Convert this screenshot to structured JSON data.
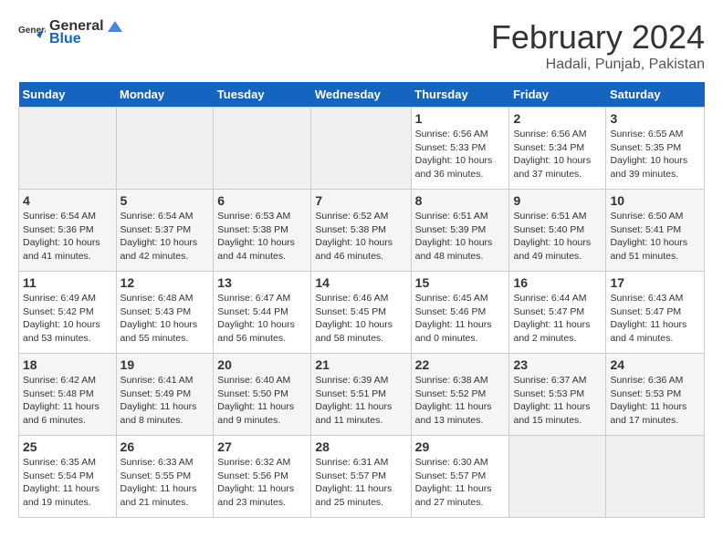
{
  "header": {
    "logo_general": "General",
    "logo_blue": "Blue",
    "title": "February 2024",
    "subtitle": "Hadali, Punjab, Pakistan"
  },
  "columns": [
    "Sunday",
    "Monday",
    "Tuesday",
    "Wednesday",
    "Thursday",
    "Friday",
    "Saturday"
  ],
  "weeks": [
    [
      {
        "day": "",
        "sunrise": "",
        "sunset": "",
        "daylight": "",
        "empty": true
      },
      {
        "day": "",
        "sunrise": "",
        "sunset": "",
        "daylight": "",
        "empty": true
      },
      {
        "day": "",
        "sunrise": "",
        "sunset": "",
        "daylight": "",
        "empty": true
      },
      {
        "day": "",
        "sunrise": "",
        "sunset": "",
        "daylight": "",
        "empty": true
      },
      {
        "day": "1",
        "sunrise": "Sunrise: 6:56 AM",
        "sunset": "Sunset: 5:33 PM",
        "daylight": "Daylight: 10 hours and 36 minutes.",
        "empty": false
      },
      {
        "day": "2",
        "sunrise": "Sunrise: 6:56 AM",
        "sunset": "Sunset: 5:34 PM",
        "daylight": "Daylight: 10 hours and 37 minutes.",
        "empty": false
      },
      {
        "day": "3",
        "sunrise": "Sunrise: 6:55 AM",
        "sunset": "Sunset: 5:35 PM",
        "daylight": "Daylight: 10 hours and 39 minutes.",
        "empty": false
      }
    ],
    [
      {
        "day": "4",
        "sunrise": "Sunrise: 6:54 AM",
        "sunset": "Sunset: 5:36 PM",
        "daylight": "Daylight: 10 hours and 41 minutes.",
        "empty": false
      },
      {
        "day": "5",
        "sunrise": "Sunrise: 6:54 AM",
        "sunset": "Sunset: 5:37 PM",
        "daylight": "Daylight: 10 hours and 42 minutes.",
        "empty": false
      },
      {
        "day": "6",
        "sunrise": "Sunrise: 6:53 AM",
        "sunset": "Sunset: 5:38 PM",
        "daylight": "Daylight: 10 hours and 44 minutes.",
        "empty": false
      },
      {
        "day": "7",
        "sunrise": "Sunrise: 6:52 AM",
        "sunset": "Sunset: 5:38 PM",
        "daylight": "Daylight: 10 hours and 46 minutes.",
        "empty": false
      },
      {
        "day": "8",
        "sunrise": "Sunrise: 6:51 AM",
        "sunset": "Sunset: 5:39 PM",
        "daylight": "Daylight: 10 hours and 48 minutes.",
        "empty": false
      },
      {
        "day": "9",
        "sunrise": "Sunrise: 6:51 AM",
        "sunset": "Sunset: 5:40 PM",
        "daylight": "Daylight: 10 hours and 49 minutes.",
        "empty": false
      },
      {
        "day": "10",
        "sunrise": "Sunrise: 6:50 AM",
        "sunset": "Sunset: 5:41 PM",
        "daylight": "Daylight: 10 hours and 51 minutes.",
        "empty": false
      }
    ],
    [
      {
        "day": "11",
        "sunrise": "Sunrise: 6:49 AM",
        "sunset": "Sunset: 5:42 PM",
        "daylight": "Daylight: 10 hours and 53 minutes.",
        "empty": false
      },
      {
        "day": "12",
        "sunrise": "Sunrise: 6:48 AM",
        "sunset": "Sunset: 5:43 PM",
        "daylight": "Daylight: 10 hours and 55 minutes.",
        "empty": false
      },
      {
        "day": "13",
        "sunrise": "Sunrise: 6:47 AM",
        "sunset": "Sunset: 5:44 PM",
        "daylight": "Daylight: 10 hours and 56 minutes.",
        "empty": false
      },
      {
        "day": "14",
        "sunrise": "Sunrise: 6:46 AM",
        "sunset": "Sunset: 5:45 PM",
        "daylight": "Daylight: 10 hours and 58 minutes.",
        "empty": false
      },
      {
        "day": "15",
        "sunrise": "Sunrise: 6:45 AM",
        "sunset": "Sunset: 5:46 PM",
        "daylight": "Daylight: 11 hours and 0 minutes.",
        "empty": false
      },
      {
        "day": "16",
        "sunrise": "Sunrise: 6:44 AM",
        "sunset": "Sunset: 5:47 PM",
        "daylight": "Daylight: 11 hours and 2 minutes.",
        "empty": false
      },
      {
        "day": "17",
        "sunrise": "Sunrise: 6:43 AM",
        "sunset": "Sunset: 5:47 PM",
        "daylight": "Daylight: 11 hours and 4 minutes.",
        "empty": false
      }
    ],
    [
      {
        "day": "18",
        "sunrise": "Sunrise: 6:42 AM",
        "sunset": "Sunset: 5:48 PM",
        "daylight": "Daylight: 11 hours and 6 minutes.",
        "empty": false
      },
      {
        "day": "19",
        "sunrise": "Sunrise: 6:41 AM",
        "sunset": "Sunset: 5:49 PM",
        "daylight": "Daylight: 11 hours and 8 minutes.",
        "empty": false
      },
      {
        "day": "20",
        "sunrise": "Sunrise: 6:40 AM",
        "sunset": "Sunset: 5:50 PM",
        "daylight": "Daylight: 11 hours and 9 minutes.",
        "empty": false
      },
      {
        "day": "21",
        "sunrise": "Sunrise: 6:39 AM",
        "sunset": "Sunset: 5:51 PM",
        "daylight": "Daylight: 11 hours and 11 minutes.",
        "empty": false
      },
      {
        "day": "22",
        "sunrise": "Sunrise: 6:38 AM",
        "sunset": "Sunset: 5:52 PM",
        "daylight": "Daylight: 11 hours and 13 minutes.",
        "empty": false
      },
      {
        "day": "23",
        "sunrise": "Sunrise: 6:37 AM",
        "sunset": "Sunset: 5:53 PM",
        "daylight": "Daylight: 11 hours and 15 minutes.",
        "empty": false
      },
      {
        "day": "24",
        "sunrise": "Sunrise: 6:36 AM",
        "sunset": "Sunset: 5:53 PM",
        "daylight": "Daylight: 11 hours and 17 minutes.",
        "empty": false
      }
    ],
    [
      {
        "day": "25",
        "sunrise": "Sunrise: 6:35 AM",
        "sunset": "Sunset: 5:54 PM",
        "daylight": "Daylight: 11 hours and 19 minutes.",
        "empty": false
      },
      {
        "day": "26",
        "sunrise": "Sunrise: 6:33 AM",
        "sunset": "Sunset: 5:55 PM",
        "daylight": "Daylight: 11 hours and 21 minutes.",
        "empty": false
      },
      {
        "day": "27",
        "sunrise": "Sunrise: 6:32 AM",
        "sunset": "Sunset: 5:56 PM",
        "daylight": "Daylight: 11 hours and 23 minutes.",
        "empty": false
      },
      {
        "day": "28",
        "sunrise": "Sunrise: 6:31 AM",
        "sunset": "Sunset: 5:57 PM",
        "daylight": "Daylight: 11 hours and 25 minutes.",
        "empty": false
      },
      {
        "day": "29",
        "sunrise": "Sunrise: 6:30 AM",
        "sunset": "Sunset: 5:57 PM",
        "daylight": "Daylight: 11 hours and 27 minutes.",
        "empty": false
      },
      {
        "day": "",
        "sunrise": "",
        "sunset": "",
        "daylight": "",
        "empty": true
      },
      {
        "day": "",
        "sunrise": "",
        "sunset": "",
        "daylight": "",
        "empty": true
      }
    ]
  ]
}
